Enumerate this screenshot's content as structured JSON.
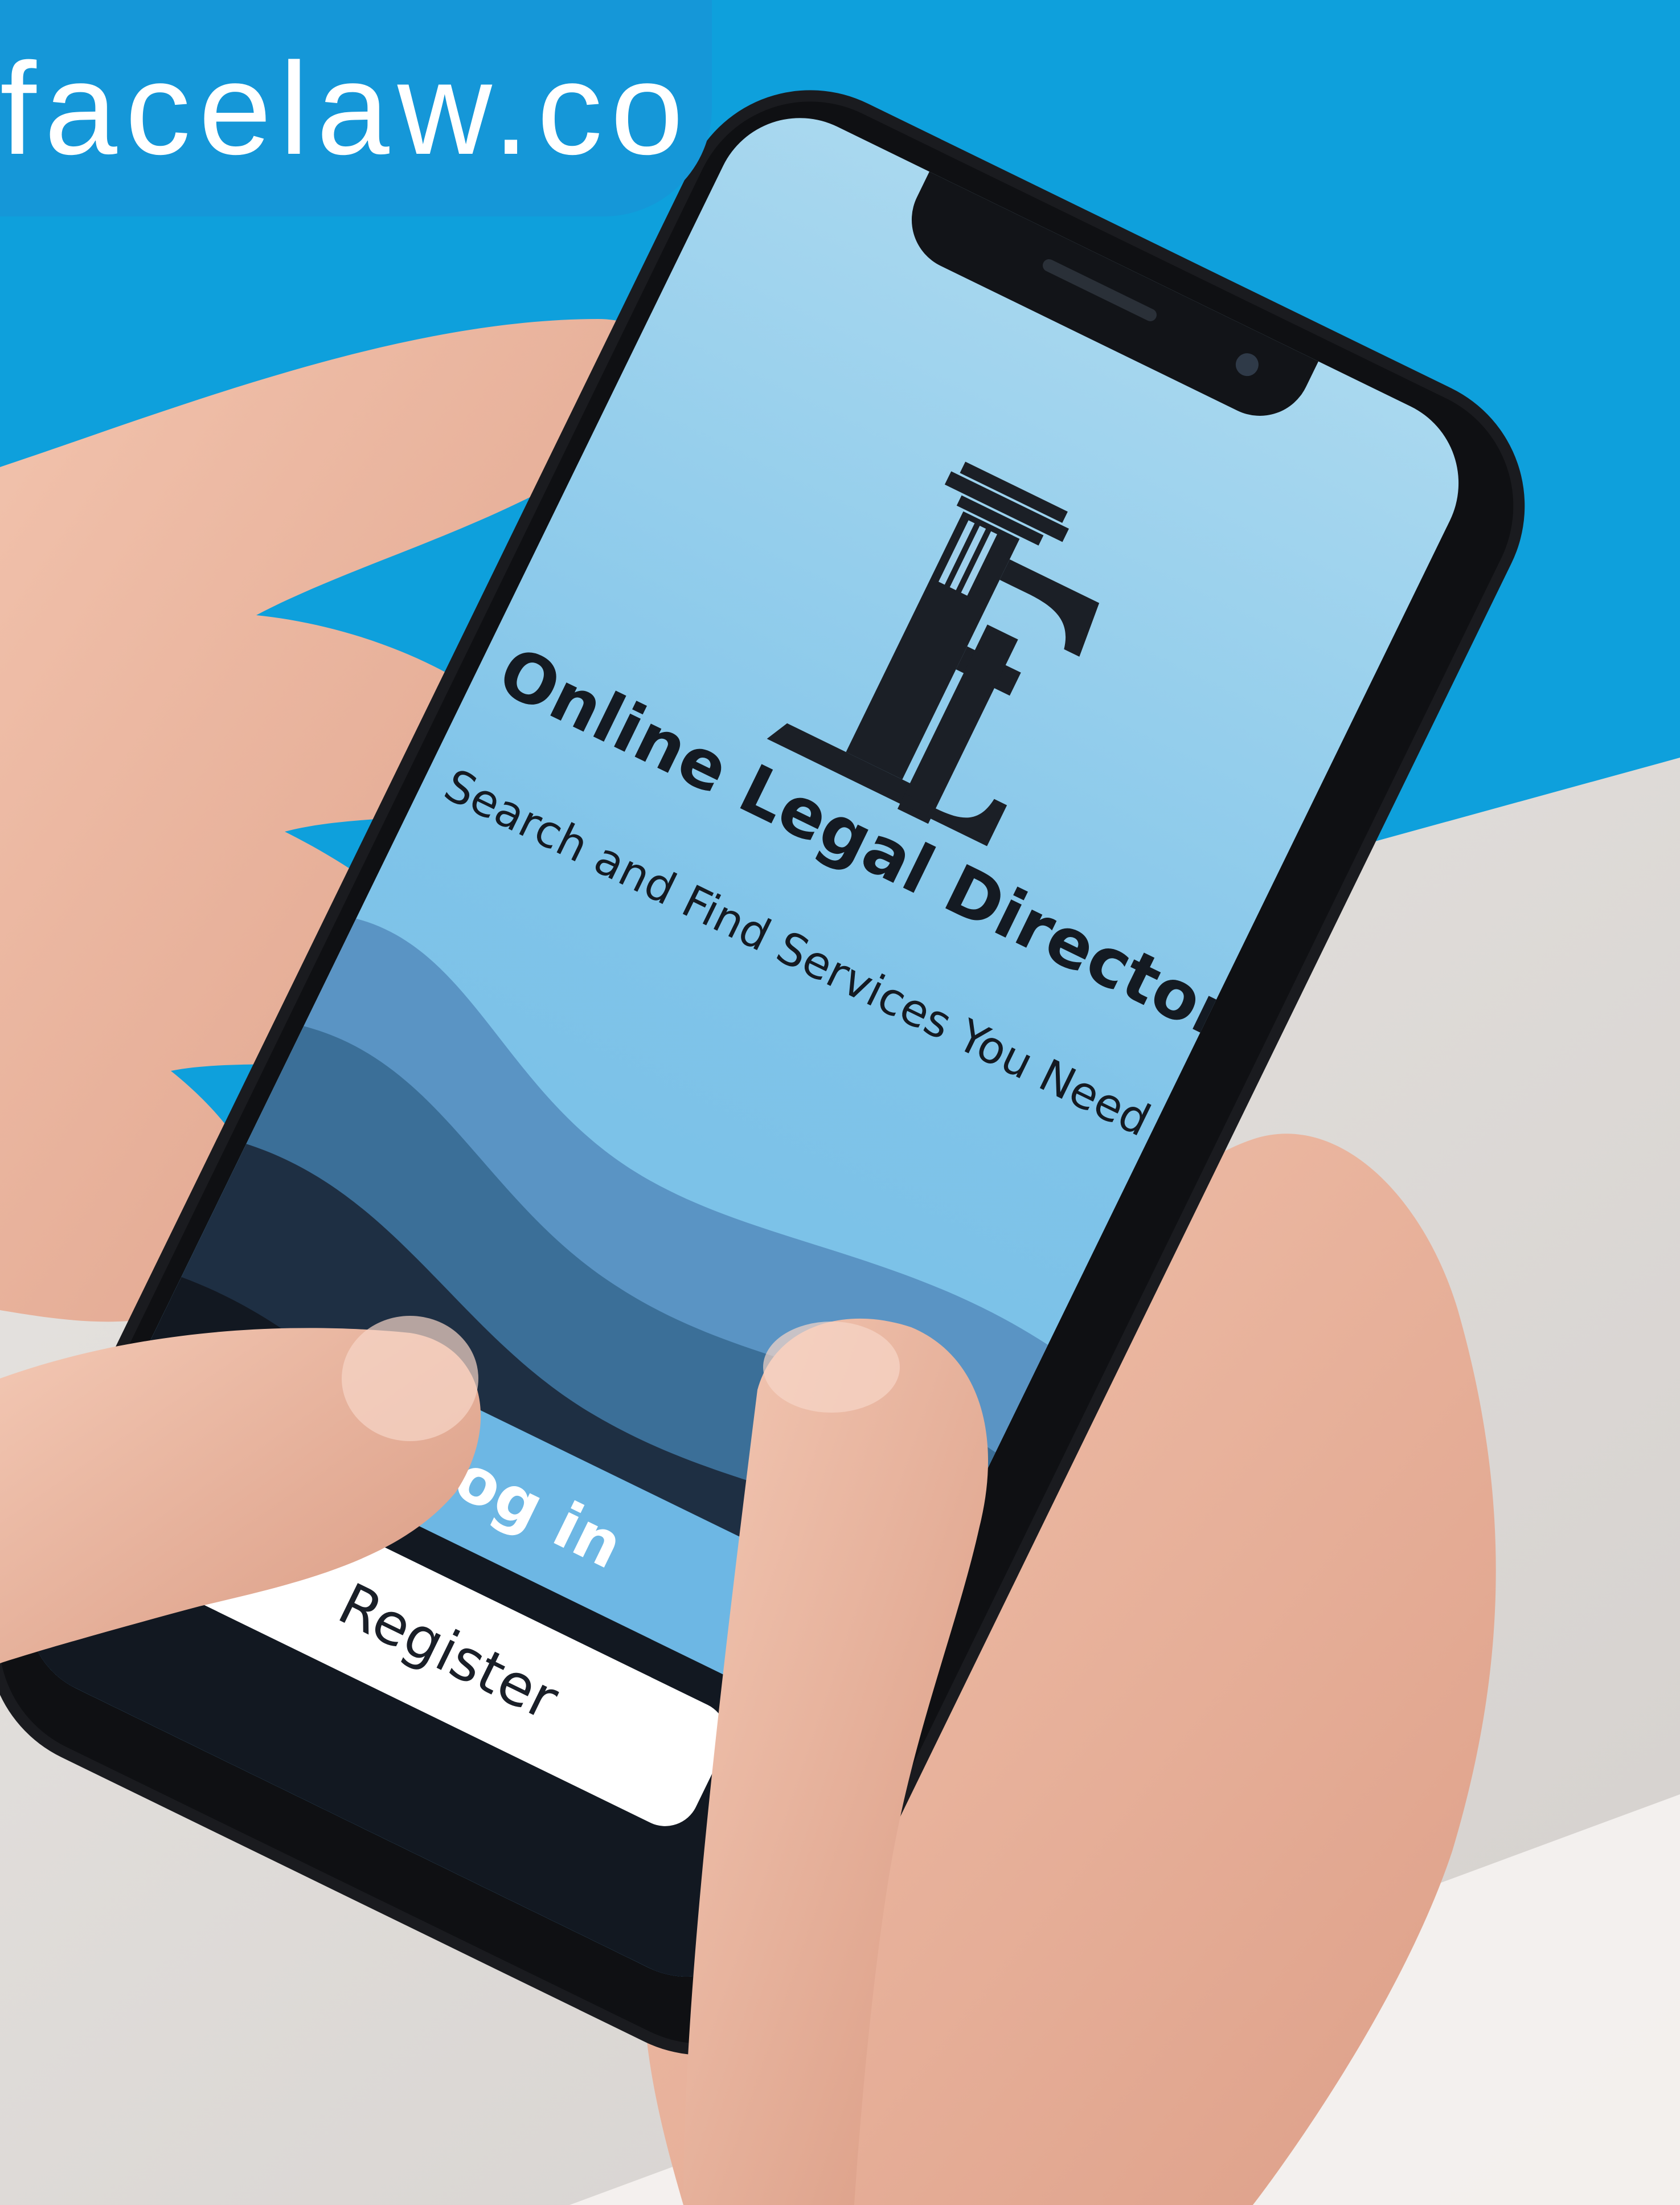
{
  "website": {
    "url_text": "facelaw.co"
  },
  "app": {
    "logo_icon": "column-fl-monogram-icon",
    "title": "Online Legal Directory",
    "subtitle": "Search and Find Services You Need",
    "login_label": "Log in",
    "register_label": "Register"
  },
  "colors": {
    "background_blue": "#0ea0dc",
    "url_pill": "#1597d8",
    "screen_blue": "#80c4e9",
    "login_button": "#6db7e4",
    "register_button": "#ffffff",
    "text_dark": "#141a22"
  }
}
